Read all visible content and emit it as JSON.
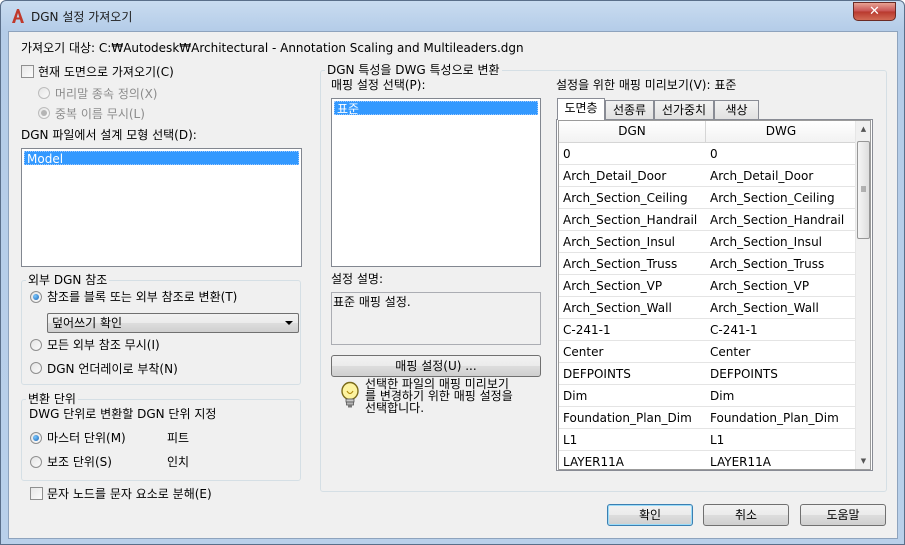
{
  "window": {
    "title": "DGN 설정 가져오기",
    "close_glyph": "✕",
    "icon": "autocad-a-icon",
    "accent": "#c0392b"
  },
  "import_target": "가져오기 대상: C:₩Autodesk₩Architectural - Annotation Scaling and Multileaders.dgn",
  "current_layout": {
    "label": "현재 도면으로 가져오기(C)",
    "checked": false,
    "options": [
      {
        "label": "머리말 종속 정의(X)",
        "selected": false,
        "enabled": false
      },
      {
        "label": "중복 이름 무시(L)",
        "selected": true,
        "enabled": false
      }
    ]
  },
  "design_model": {
    "label": "DGN 파일에서 설계 모형 선택(D):",
    "items": [
      "Model"
    ],
    "selected": "Model"
  },
  "external_refs": {
    "title": "외부 DGN 참조",
    "options": [
      {
        "label": "참조를 블록 또는 외부 참조로 변환(T)",
        "selected": true
      },
      {
        "label": "모든 외부 참조 무시(I)",
        "selected": false
      },
      {
        "label": "DGN 언더레이로 부착(N)",
        "selected": false
      }
    ],
    "combo_value": "덮어쓰기 확인"
  },
  "units": {
    "title": "변환 단위",
    "desc": "DWG 단위로 변환할 DGN 단위 지정",
    "options": [
      {
        "label": "마스터 단위(M)",
        "value": "피트",
        "selected": true
      },
      {
        "label": "보조 단위(S)",
        "value": "인치",
        "selected": false
      }
    ]
  },
  "explode_text": {
    "label": "문자 노드를 문자 요소로 분해(E)",
    "checked": false
  },
  "mapping": {
    "group_title": "DGN 특성을 DWG 특성으로 변환",
    "select_label": "매핑 설정 선택(P):",
    "items": [
      "표준"
    ],
    "selected": "표준",
    "desc_label": "설정 설명:",
    "desc_value": "표준 매핑 설정.",
    "settings_button": "매핑 설정(U) ...",
    "hint": "선택한 파일의 매핑 미리보기를 변경하기 위한 매핑 설정을 선택합니다.",
    "hint_lines": [
      "선택한 파일의 매핑 미리보기",
      "를 변경하기 위한 매핑 설정을",
      "선택합니다."
    ],
    "hint_icon": "lightbulb-icon"
  },
  "preview": {
    "label": "설정을 위한 매핑 미리보기(V): 표준",
    "tabs": [
      "도면층",
      "선종류",
      "선가중치",
      "색상"
    ],
    "active_tab": 0,
    "columns": [
      "DGN",
      "DWG"
    ],
    "rows": [
      [
        "0",
        "0"
      ],
      [
        "Arch_Detail_Door",
        "Arch_Detail_Door"
      ],
      [
        "Arch_Section_Ceiling",
        "Arch_Section_Ceiling"
      ],
      [
        "Arch_Section_Handrail",
        "Arch_Section_Handrail"
      ],
      [
        "Arch_Section_Insul",
        "Arch_Section_Insul"
      ],
      [
        "Arch_Section_Truss",
        "Arch_Section_Truss"
      ],
      [
        "Arch_Section_VP",
        "Arch_Section_VP"
      ],
      [
        "Arch_Section_Wall",
        "Arch_Section_Wall"
      ],
      [
        "C-241-1",
        "C-241-1"
      ],
      [
        "Center",
        "Center"
      ],
      [
        "DEFPOINTS",
        "DEFPOINTS"
      ],
      [
        "Dim",
        "Dim"
      ],
      [
        "Foundation_Plan_Dim",
        "Foundation_Plan_Dim"
      ],
      [
        "L1",
        "L1"
      ],
      [
        "LAYER11A",
        "LAYER11A"
      ]
    ]
  },
  "buttons": {
    "ok": "확인",
    "cancel": "취소",
    "help": "도움말"
  }
}
